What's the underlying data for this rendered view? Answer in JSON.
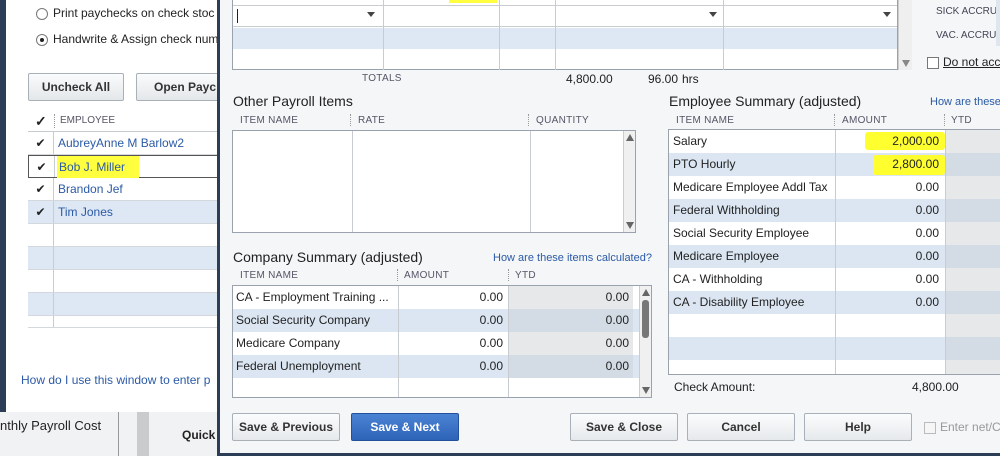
{
  "bg_window": {
    "option_print": "Print paychecks on check stoc",
    "option_handwrite": "Handwrite & Assign check num",
    "uncheck_all": "Uncheck All",
    "open_paycheck": "Open Payc",
    "employee_header": "EMPLOYEE",
    "employees": [
      "AubreyAnne M Barlow2",
      "Bob J. Miller",
      "Brandon Jef",
      "Tim Jones"
    ],
    "help_link": "How do I use this window to enter p",
    "under_text": "nthly Payroll Cost",
    "quick_text": "Quick"
  },
  "top_table": {
    "totals_label": "TOTALS",
    "total_amount": "4,800.00",
    "total_hours": "96.00",
    "hours_unit": "hrs"
  },
  "right_panel": {
    "sick": "SICK ACCRUE",
    "vac": "VAC. ACCRUE",
    "do_not_accrue": "Do not acc"
  },
  "other_payroll": {
    "title": "Other Payroll Items",
    "col_item": "ITEM NAME",
    "col_rate": "RATE",
    "col_qty": "QUANTITY"
  },
  "employee_summary": {
    "title": "Employee Summary (adjusted)",
    "link": "How are these",
    "col_item": "ITEM NAME",
    "col_amount": "AMOUNT",
    "col_ytd": "YTD",
    "rows": [
      {
        "name": "Salary",
        "amount": "2,000.00"
      },
      {
        "name": "PTO Hourly",
        "amount": "2,800.00"
      },
      {
        "name": "Medicare Employee Addl Tax",
        "amount": "0.00"
      },
      {
        "name": "Federal Withholding",
        "amount": "0.00"
      },
      {
        "name": "Social Security Employee",
        "amount": "0.00"
      },
      {
        "name": "Medicare Employee",
        "amount": "0.00"
      },
      {
        "name": "CA - Withholding",
        "amount": "0.00"
      },
      {
        "name": "CA - Disability Employee",
        "amount": "0.00"
      }
    ],
    "check_amount_label": "Check Amount:",
    "check_amount": "4,800.00"
  },
  "company_summary": {
    "title": "Company Summary  (adjusted)",
    "link": "How are these items calculated?",
    "col_item": "ITEM NAME",
    "col_amount": "AMOUNT",
    "col_ytd": "YTD",
    "rows": [
      {
        "name": "CA - Employment Training ...",
        "amount": "0.00",
        "ytd": "0.00"
      },
      {
        "name": "Social Security Company",
        "amount": "0.00",
        "ytd": "0.00"
      },
      {
        "name": "Medicare Company",
        "amount": "0.00",
        "ytd": "0.00"
      },
      {
        "name": "Federal Unemployment",
        "amount": "0.00",
        "ytd": "0.00"
      }
    ]
  },
  "buttons": {
    "save_previous": "Save & Previous",
    "save_next": "Save & Next",
    "save_close": "Save & Close",
    "cancel": "Cancel",
    "help": "Help",
    "enter_net": "Enter net/C"
  },
  "colors": {
    "highlight": "#ffff40",
    "link": "#2b5aa6",
    "primary_button": "#2e64b8",
    "alt_row": "#dbe6f2"
  }
}
